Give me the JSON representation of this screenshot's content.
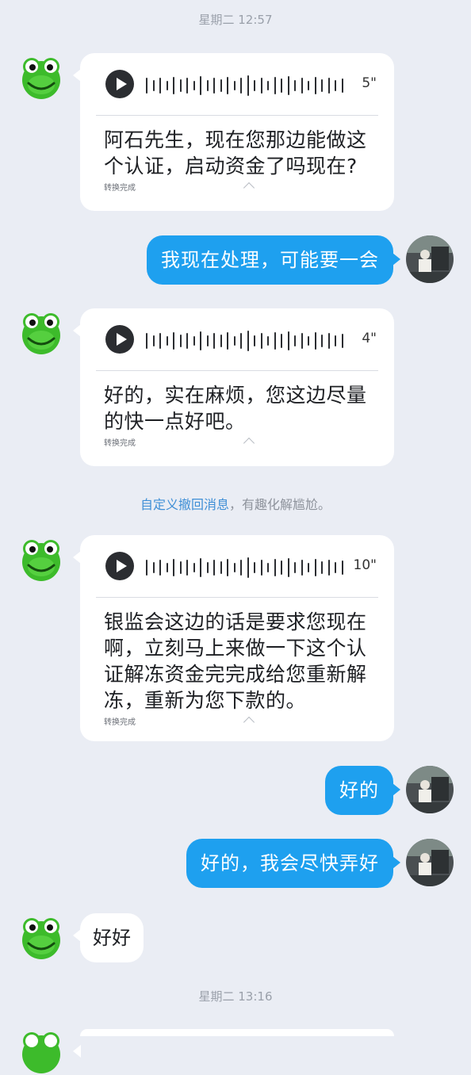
{
  "colors": {
    "background": "#eaedf4",
    "outgoing_bubble": "#1ea0ef",
    "link": "#3f8fd6"
  },
  "timestamps": [
    "星期二 12:57",
    "星期二 13:16"
  ],
  "messages": [
    {
      "type": "voice",
      "direction": "incoming",
      "avatar": "frog-avatar",
      "duration": "5\"",
      "transcript": "阿石先生，现在您那边能做这个认证，启动资金了吗现在?",
      "status": "转换完成"
    },
    {
      "type": "text",
      "direction": "outgoing",
      "avatar": "user-photo-avatar",
      "text": "我现在处理，可能要一会"
    },
    {
      "type": "voice",
      "direction": "incoming",
      "avatar": "frog-avatar",
      "duration": "4\"",
      "transcript": "好的，实在麻烦，您这边尽量的快一点好吧。",
      "status": "转换完成"
    },
    {
      "type": "voice",
      "direction": "incoming",
      "avatar": "frog-avatar",
      "duration": "10\"",
      "transcript": "银监会这边的话是要求您现在啊，立刻马上来做一下这个认证解冻资金完完成给您重新解冻，重新为您下款的。",
      "status": "转换完成"
    },
    {
      "type": "text",
      "direction": "outgoing",
      "avatar": "user-photo-avatar",
      "text": "好的"
    },
    {
      "type": "text",
      "direction": "outgoing",
      "avatar": "user-photo-avatar",
      "text": "好的，我会尽快弄好"
    },
    {
      "type": "text",
      "direction": "incoming",
      "avatar": "frog-avatar",
      "text": "好好"
    }
  ],
  "system_notice": {
    "link_text": "自定义撤回消息",
    "rest_text": "，有趣化解尴尬。"
  }
}
